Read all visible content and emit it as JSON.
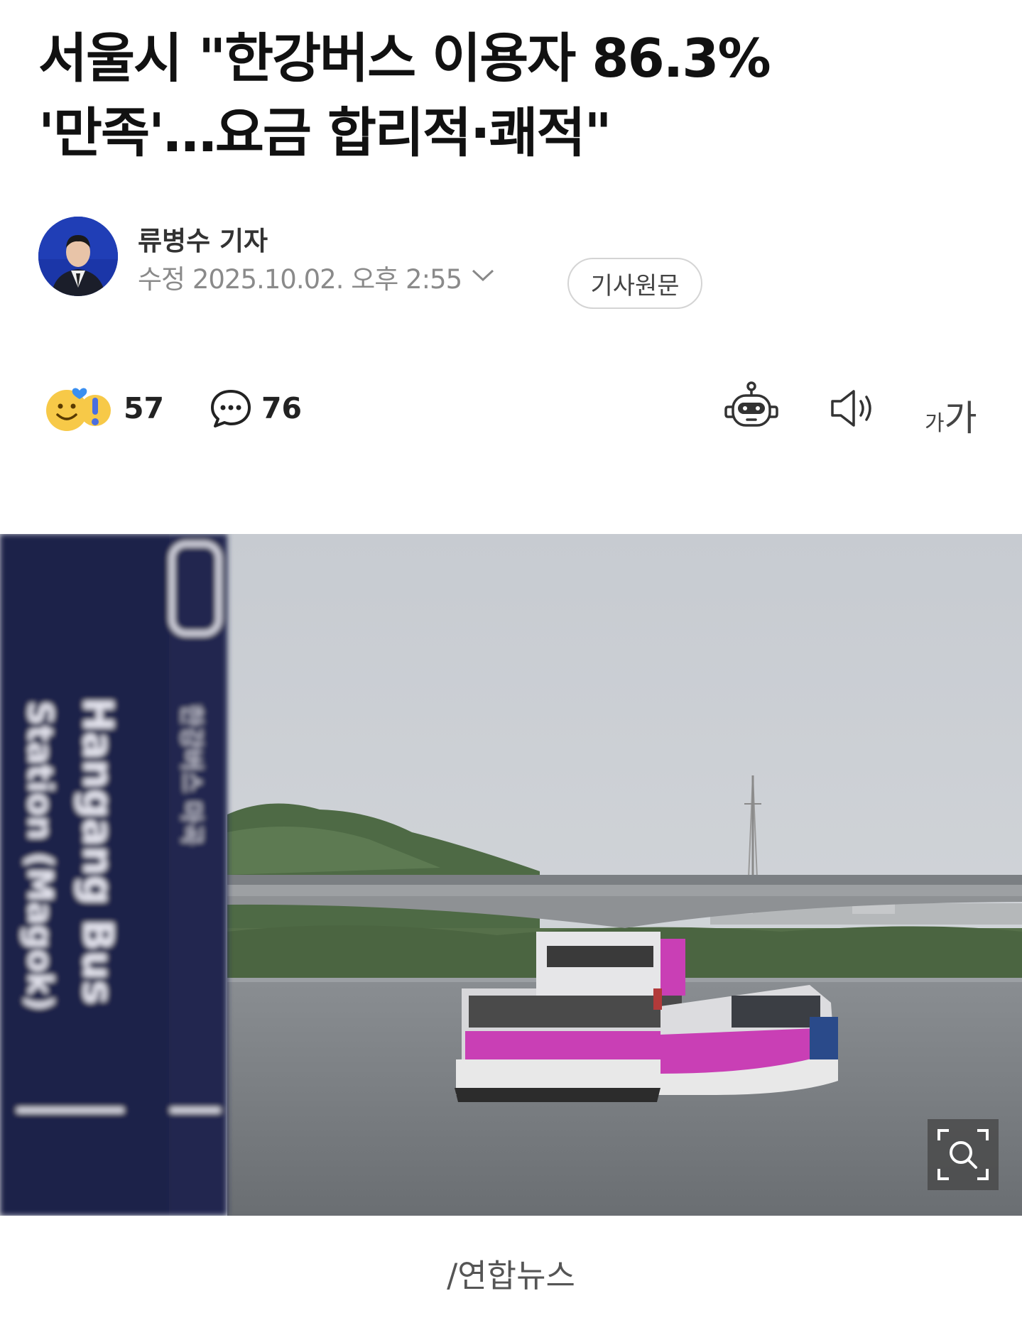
{
  "article": {
    "headline_line1": "서울시 \"한강버스 이용자 86.3%",
    "headline_line2": "'만족'…요금 합리적·쾌적\""
  },
  "byline": {
    "author": "류병수 기자",
    "edited": "수정 2025.10.02. 오후 2:55",
    "original_button": "기사원문"
  },
  "toolbar": {
    "reaction_count": "57",
    "comment_count": "76",
    "font_size_small": "가",
    "font_size_large": "가",
    "icons": [
      "reaction-emoji-icon",
      "comment-icon",
      "ai-summary-robot-icon",
      "speaker-icon",
      "font-size-icon"
    ]
  },
  "photo": {
    "sign_line1": "Hangang Bus",
    "sign_line2": "Station (Magok)",
    "sign_korean": "한강버스 마곡",
    "caption": "/연합뉴스"
  },
  "colors": {
    "headline": "#111111",
    "meta": "#8a8a8a",
    "boat_pink": "#c93fb5",
    "sign_navy": "#1c2249",
    "sky": "#c9cdd2",
    "water": "#707478"
  }
}
